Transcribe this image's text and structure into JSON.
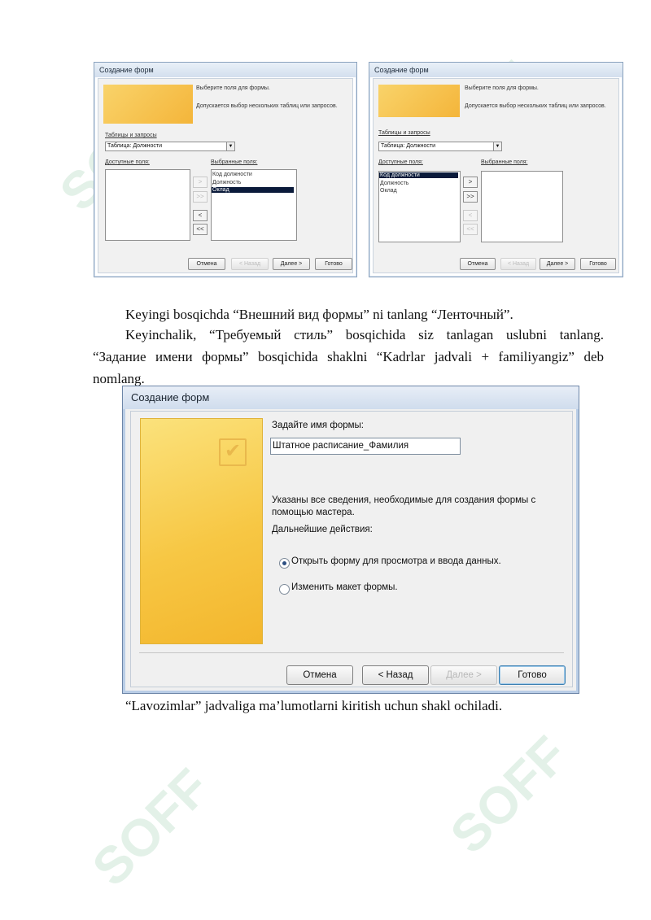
{
  "dialog_left": {
    "title": "Создание форм",
    "hint1": "Выберите поля для формы.",
    "hint2": "Допускается выбор нескольких таблиц или запросов.",
    "tables_label": "Таблицы и запросы",
    "combo_value": "Таблица: Должности",
    "available_label": "Доступные поля:",
    "selected_label": "Выбранные поля:",
    "selected_fields": [
      "Код должности",
      "Должность",
      "Оклад"
    ],
    "move_buttons": [
      ">",
      ">>",
      "<",
      "<<"
    ],
    "buttons": [
      "Отмена",
      "< Назад",
      "Далее >",
      "Готово"
    ]
  },
  "dialog_right": {
    "title": "Создание форм",
    "hint1": "Выберите поля для формы.",
    "hint2": "Допускается выбор нескольких таблиц или запросов.",
    "tables_label": "Таблицы и запросы",
    "combo_value": "Таблица: Должности",
    "available_label": "Доступные поля:",
    "selected_label": "Выбранные поля:",
    "available_fields": [
      "Код должности",
      "Должность",
      "Оклад"
    ],
    "move_buttons": [
      ">",
      ">>",
      "<",
      "<<"
    ],
    "buttons": [
      "Отмена",
      "< Назад",
      "Далее >",
      "Готово"
    ]
  },
  "text": {
    "p1": "Keyingi bosqichda “Внешний вид формы” ni tanlang “Ленточный”.",
    "p2_line1": "Keyinchalik, “Требуемый стиль” bosqichida siz tanlagan uslubni tanlang.",
    "p2_line2": "“Задание имени формы” bosqichida shaklni “Kadrlar jadvali + familiyangiz” deb",
    "p2_line3": "nomlang.",
    "p3": "“Lavozimlar” jadvaliga ma’lumotlarni kiritish uchun shakl ochiladi."
  },
  "dialog_main": {
    "title": "Создание форм",
    "name_prompt": "Задайте имя формы:",
    "name_value": "Штатное расписание_Фамилия",
    "info_line1": "Указаны все сведения, необходимые для создания формы с",
    "info_line2": "помощью мастера.",
    "next_actions": "Дальнейшие действия:",
    "option1": "Открыть форму для просмотра и ввода данных.",
    "option2": "Изменить макет формы.",
    "option1_checked": true,
    "btn_cancel": "Отмена",
    "btn_back": "< Назад",
    "btn_next": "Далее >",
    "btn_finish": "Готово"
  },
  "watermark": {
    "text": "SOFF",
    "color": "#50aa6e"
  }
}
